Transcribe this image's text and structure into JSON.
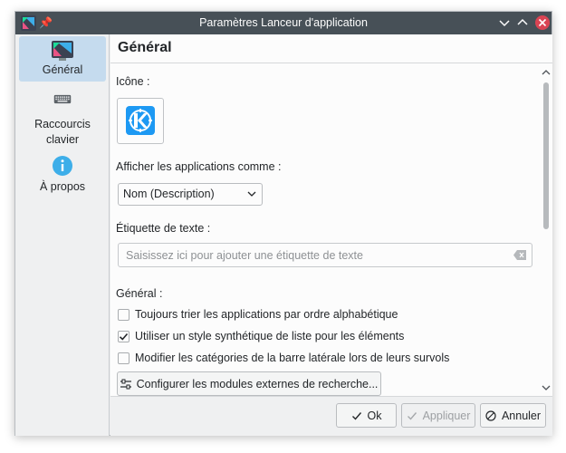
{
  "window": {
    "title": "Paramètres Lanceur d'application",
    "app_icon": "application-launcher-icon",
    "pin_icon": "pin-icon",
    "controls": [
      "minimize-icon",
      "maximize-icon",
      "close-icon"
    ],
    "close_color": "#da4453",
    "titlebar_color": "#475057"
  },
  "sidebar": {
    "items": [
      {
        "label": "Général",
        "icon": "general-settings-icon",
        "selected": true
      },
      {
        "label": "Raccourcis clavier",
        "icon": "keyboard-icon",
        "selected": false
      },
      {
        "label": "À propos",
        "icon": "info-icon",
        "selected": false
      }
    ],
    "selected_color": "#c5dbee"
  },
  "main": {
    "title": "Général",
    "icon_label": "Icône :",
    "icon_name": "kde-logo-icon",
    "display_label": "Afficher les applications comme :",
    "display_value": "Nom (Description)",
    "text_label_title": "Étiquette de texte :",
    "text_label_placeholder": "Saisissez ici pour ajouter une étiquette de texte",
    "general_label": "Général :",
    "options": [
      {
        "label": "Toujours trier les applications par ordre alphabétique",
        "checked": false
      },
      {
        "label": "Utiliser un style synthétique de liste pour les éléments",
        "checked": true
      },
      {
        "label": "Modifier les catégories de la barre latérale lors de leurs survols",
        "checked": false
      }
    ],
    "configure_button": "Configurer les modules externes de recherche..."
  },
  "footer": {
    "ok": "Ok",
    "apply": "Appliquer",
    "cancel": "Annuler"
  }
}
